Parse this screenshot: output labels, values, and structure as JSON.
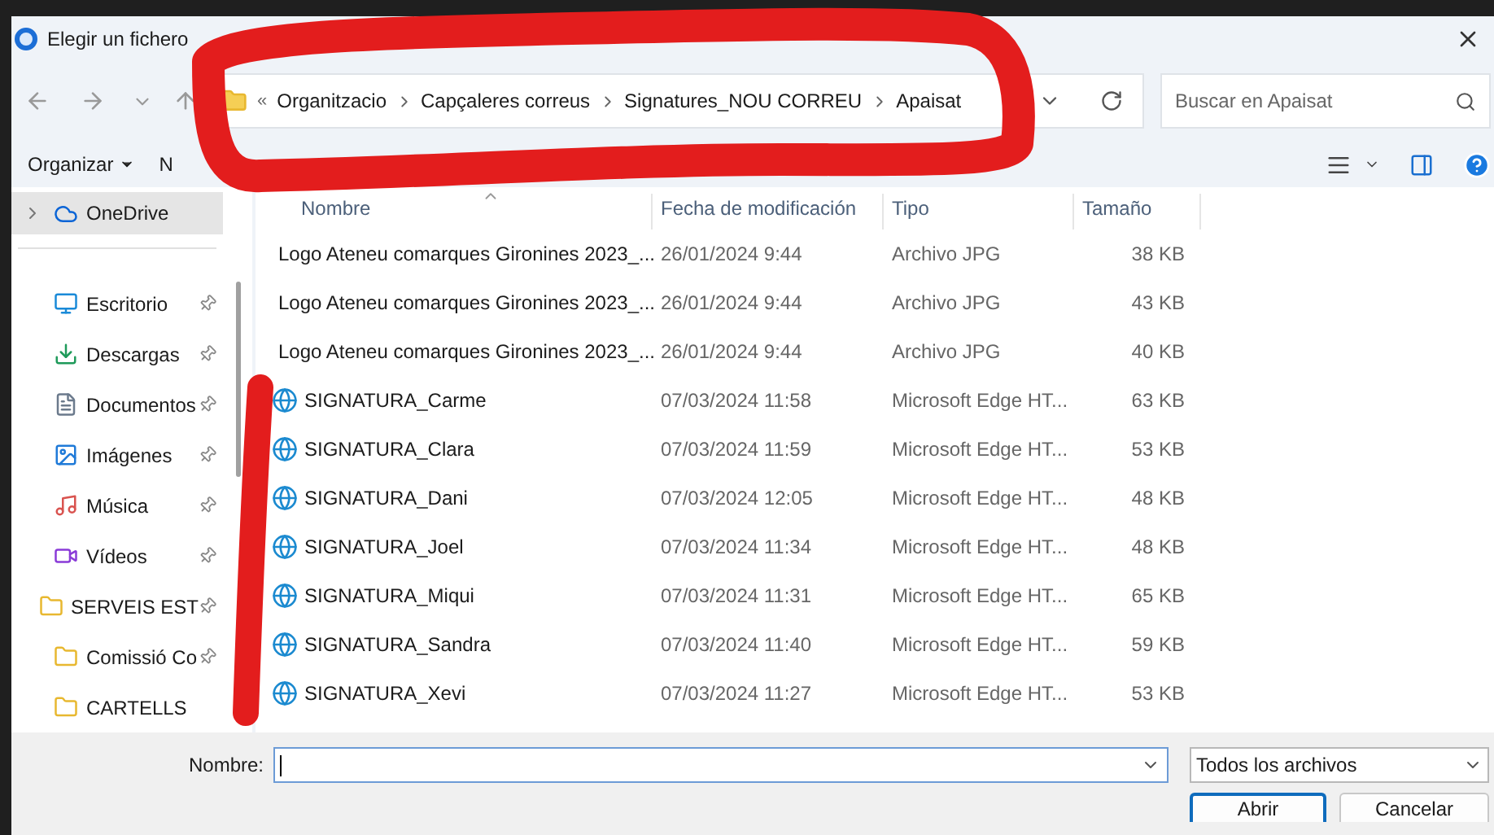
{
  "window": {
    "title": "Elegir un fichero"
  },
  "address": {
    "overflow": "«",
    "crumbs": [
      "Organitzacio",
      "Capçaleres correus",
      "Signatures_NOU CORREU",
      "Apaisat"
    ]
  },
  "search": {
    "placeholder": "Buscar en Apaisat"
  },
  "toolbar": {
    "organize": "Organizar",
    "new_folder": "N"
  },
  "sidebar": {
    "cloud": [
      {
        "label": "OneDrive",
        "kind": "onedrive",
        "selected": true,
        "expandable": true
      }
    ],
    "quick_access": [
      {
        "label": "Escritorio",
        "kind": "desktop",
        "pinned": true
      },
      {
        "label": "Descargas",
        "kind": "downloads",
        "pinned": true
      },
      {
        "label": "Documentos",
        "kind": "documents",
        "pinned": true
      },
      {
        "label": "Imágenes",
        "kind": "pictures",
        "pinned": true
      },
      {
        "label": "Música",
        "kind": "music",
        "pinned": true
      },
      {
        "label": "Vídeos",
        "kind": "videos",
        "pinned": true
      },
      {
        "label": "SERVEIS EST",
        "kind": "folder",
        "pinned": true
      },
      {
        "label": "Comissió Co",
        "kind": "folder",
        "pinned": true
      },
      {
        "label": "CARTELLS",
        "kind": "folder",
        "pinned": false
      }
    ]
  },
  "file_list": {
    "columns": [
      "Nombre",
      "Fecha de modificación",
      "Tipo",
      "Tamaño"
    ],
    "rows": [
      {
        "kind": "jpg",
        "name": "Logo Ateneu comarques Gironines 2023_...",
        "date": "26/01/2024 9:44",
        "type": "Archivo JPG",
        "size": "38 KB"
      },
      {
        "kind": "jpg",
        "name": "Logo Ateneu comarques Gironines 2023_...",
        "date": "26/01/2024 9:44",
        "type": "Archivo JPG",
        "size": "43 KB"
      },
      {
        "kind": "jpg",
        "name": "Logo Ateneu comarques Gironines 2023_...",
        "date": "26/01/2024 9:44",
        "type": "Archivo JPG",
        "size": "40 KB"
      },
      {
        "kind": "html",
        "name": "SIGNATURA_Carme",
        "date": "07/03/2024 11:58",
        "type": "Microsoft Edge HT...",
        "size": "63 KB"
      },
      {
        "kind": "html",
        "name": "SIGNATURA_Clara",
        "date": "07/03/2024 11:59",
        "type": "Microsoft Edge HT...",
        "size": "53 KB"
      },
      {
        "kind": "html",
        "name": "SIGNATURA_Dani",
        "date": "07/03/2024 12:05",
        "type": "Microsoft Edge HT...",
        "size": "48 KB"
      },
      {
        "kind": "html",
        "name": "SIGNATURA_Joel",
        "date": "07/03/2024 11:34",
        "type": "Microsoft Edge HT...",
        "size": "48 KB"
      },
      {
        "kind": "html",
        "name": "SIGNATURA_Miqui",
        "date": "07/03/2024 11:31",
        "type": "Microsoft Edge HT...",
        "size": "65 KB"
      },
      {
        "kind": "html",
        "name": "SIGNATURA_Sandra",
        "date": "07/03/2024 11:40",
        "type": "Microsoft Edge HT...",
        "size": "59 KB"
      },
      {
        "kind": "html",
        "name": "SIGNATURA_Xevi",
        "date": "07/03/2024 11:27",
        "type": "Microsoft Edge HT...",
        "size": "53 KB"
      }
    ]
  },
  "footer": {
    "filename_label": "Nombre:",
    "filter": "Todos los archivos",
    "buttons": [
      {
        "label": "Abrir",
        "default": true
      },
      {
        "label": "Cancelar",
        "default": false
      }
    ]
  }
}
